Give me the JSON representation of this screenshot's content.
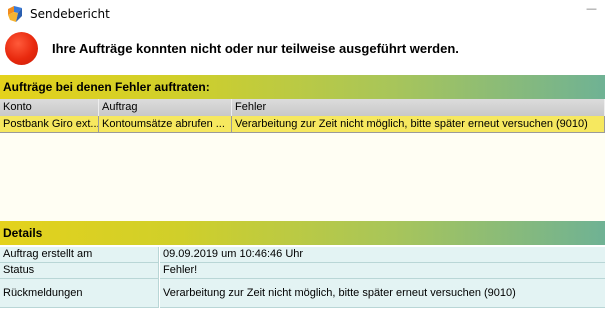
{
  "window": {
    "title": "Sendebericht",
    "close_glyph": "—"
  },
  "status": {
    "icon": "red-circle-icon",
    "color": "#e8290e",
    "message": "Ihre Aufträge konnten nicht oder nur teilweise ausgeführt werden."
  },
  "errors_section": {
    "title": "Aufträge bei denen Fehler auftraten:",
    "columns": [
      "Konto",
      "Auftrag",
      "Fehler"
    ],
    "rows": [
      [
        "Postbank Giro ext...",
        "Kontoumsätze abrufen ...",
        "Verarbeitung zur Zeit nicht möglich, bitte später erneut versuchen (9010)"
      ]
    ],
    "selected_row_color": "#f6e85f"
  },
  "details_section": {
    "title": "Details",
    "rows": [
      {
        "label": "Auftrag erstellt am",
        "value": "09.09.2019 um 10:46:46 Uhr"
      },
      {
        "label": "Status",
        "value": "Fehler!"
      },
      {
        "label": "Rückmeldungen",
        "value": "Verarbeitung zur Zeit nicht möglich, bitte später erneut versuchen (9010)"
      }
    ]
  }
}
